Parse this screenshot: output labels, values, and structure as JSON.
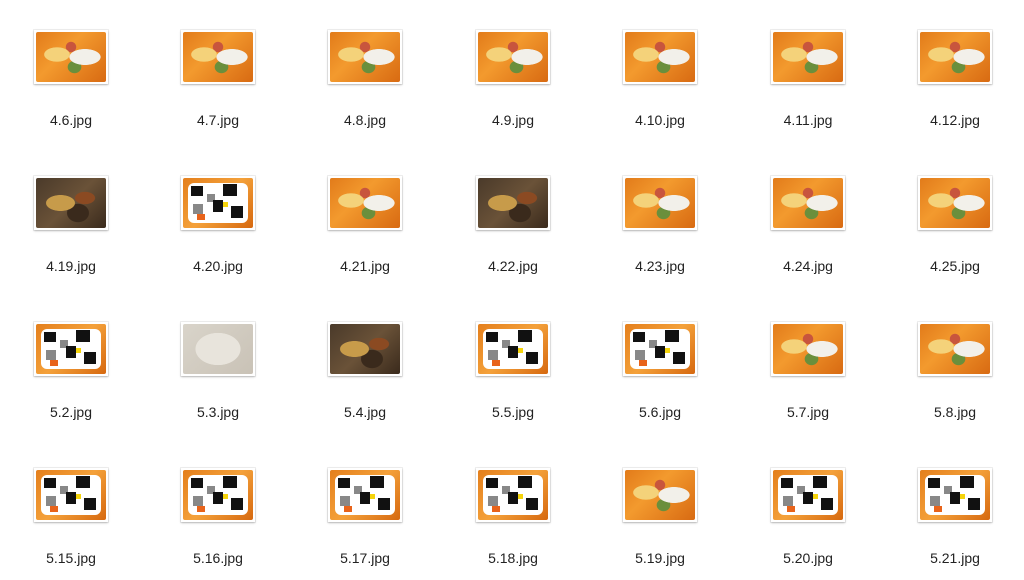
{
  "files": [
    {
      "name": "4.6.jpg",
      "kind": "food"
    },
    {
      "name": "4.7.jpg",
      "kind": "food"
    },
    {
      "name": "4.8.jpg",
      "kind": "food"
    },
    {
      "name": "4.9.jpg",
      "kind": "food"
    },
    {
      "name": "4.10.jpg",
      "kind": "food"
    },
    {
      "name": "4.11.jpg",
      "kind": "food"
    },
    {
      "name": "4.12.jpg",
      "kind": "food"
    },
    {
      "name": "4.19.jpg",
      "kind": "food-dark"
    },
    {
      "name": "4.20.jpg",
      "kind": "placeholder"
    },
    {
      "name": "4.21.jpg",
      "kind": "food"
    },
    {
      "name": "4.22.jpg",
      "kind": "food-dark"
    },
    {
      "name": "4.23.jpg",
      "kind": "food"
    },
    {
      "name": "4.24.jpg",
      "kind": "food"
    },
    {
      "name": "4.25.jpg",
      "kind": "food"
    },
    {
      "name": "5.2.jpg",
      "kind": "placeholder"
    },
    {
      "name": "5.3.jpg",
      "kind": "food-pale"
    },
    {
      "name": "5.4.jpg",
      "kind": "food-dark"
    },
    {
      "name": "5.5.jpg",
      "kind": "placeholder"
    },
    {
      "name": "5.6.jpg",
      "kind": "placeholder"
    },
    {
      "name": "5.7.jpg",
      "kind": "food"
    },
    {
      "name": "5.8.jpg",
      "kind": "food"
    },
    {
      "name": "5.15.jpg",
      "kind": "placeholder"
    },
    {
      "name": "5.16.jpg",
      "kind": "placeholder"
    },
    {
      "name": "5.17.jpg",
      "kind": "placeholder"
    },
    {
      "name": "5.18.jpg",
      "kind": "placeholder"
    },
    {
      "name": "5.19.jpg",
      "kind": "food"
    },
    {
      "name": "5.20.jpg",
      "kind": "placeholder"
    },
    {
      "name": "5.21.jpg",
      "kind": "placeholder"
    }
  ]
}
